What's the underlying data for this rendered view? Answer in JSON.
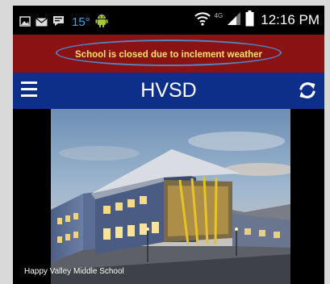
{
  "status_bar": {
    "temperature": "15°",
    "network": "4G",
    "time": "12:16 PM",
    "icons": [
      "gallery-icon",
      "mail-icon",
      "message-icon",
      "android-icon",
      "wifi-icon",
      "signal-icon",
      "battery-icon"
    ]
  },
  "alert": {
    "message": "School is closed due to inclement weather",
    "background_color": "#8a1212",
    "text_color": "#ffe36b"
  },
  "header": {
    "title": "HVSD",
    "background_color": "#0d2f89"
  },
  "hero": {
    "caption": "Happy Valley Middle School"
  }
}
